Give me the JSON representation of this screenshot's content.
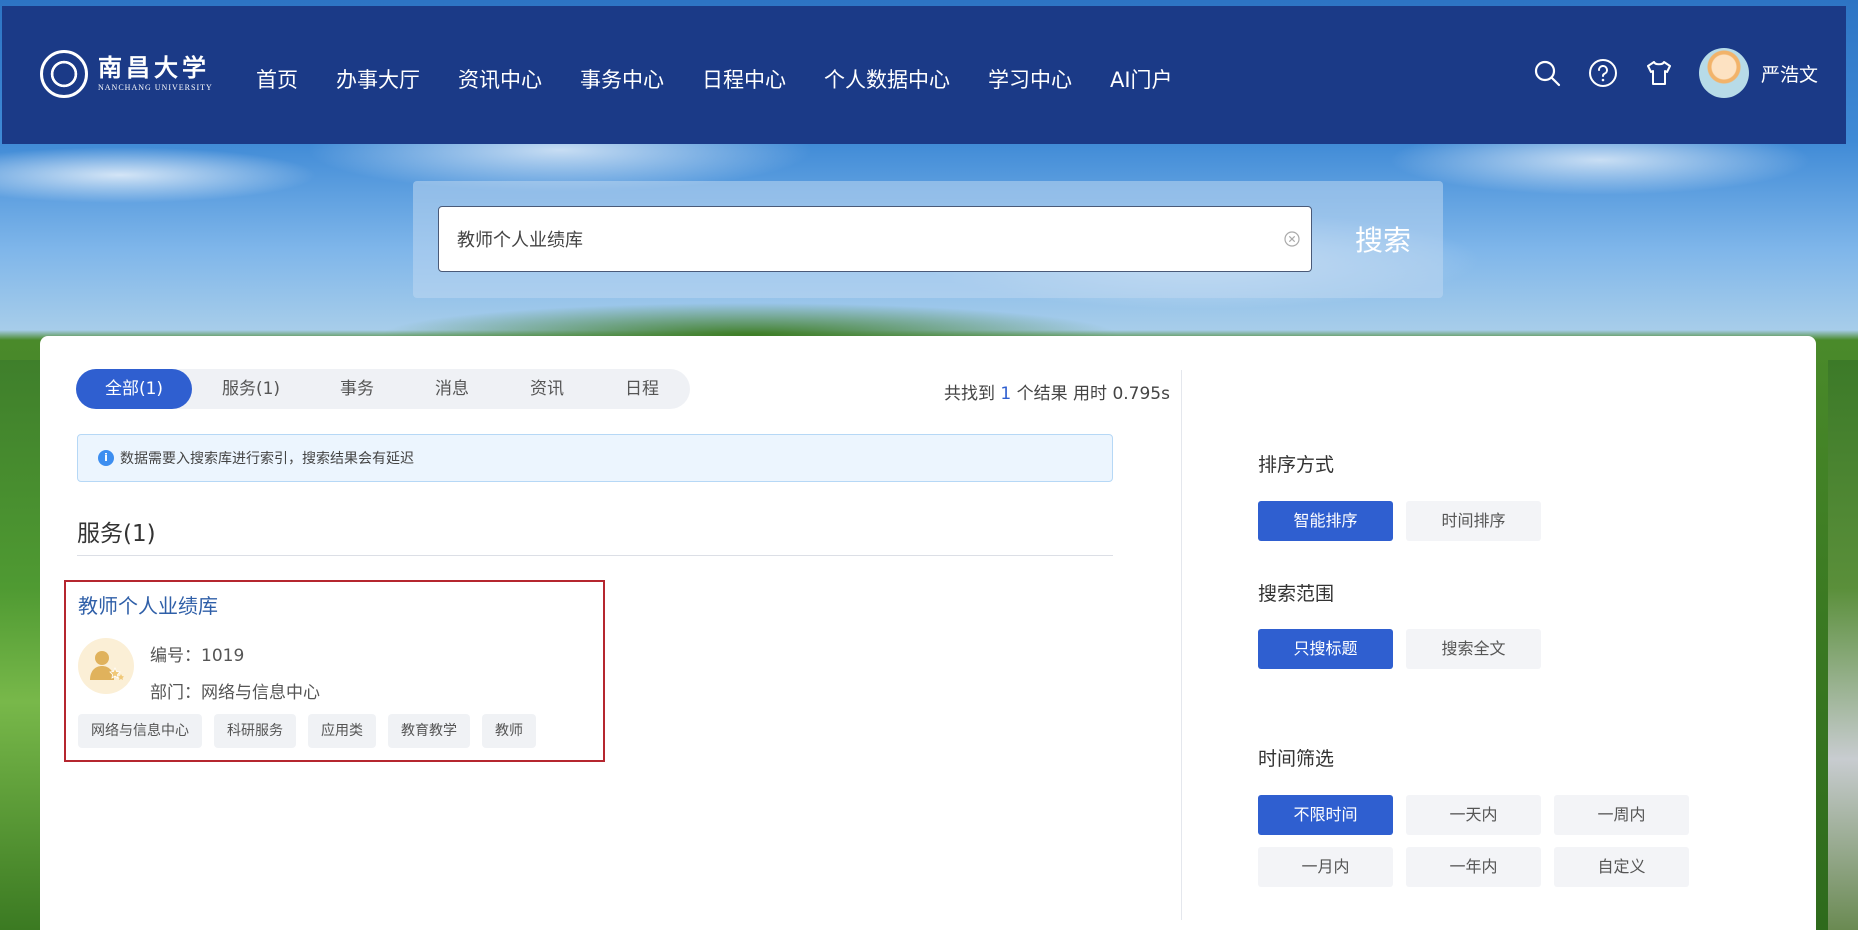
{
  "header": {
    "logo_cn": "南昌大学",
    "logo_en": "NANCHANG UNIVERSITY",
    "nav": [
      "首页",
      "办事大厅",
      "资讯中心",
      "事务中心",
      "日程中心",
      "个人数据中心",
      "学习中心",
      "AI门户"
    ],
    "icons": [
      "search-icon",
      "help-icon",
      "shirt-icon"
    ],
    "username": "严浩文"
  },
  "search": {
    "value": "教师个人业绩库",
    "button_label": "搜索"
  },
  "tabs": [
    {
      "label": "全部(1)",
      "active": true
    },
    {
      "label": "服务(1)",
      "active": false
    },
    {
      "label": "事务",
      "active": false
    },
    {
      "label": "消息",
      "active": false
    },
    {
      "label": "资讯",
      "active": false
    },
    {
      "label": "日程",
      "active": false
    }
  ],
  "result_info": {
    "prefix": "共找到",
    "count": "1",
    "middle": "个结果 用时",
    "time": "0.795s"
  },
  "notice": "数据需要入搜索库进行索引，搜索结果会有延迟",
  "section_title": "服务(1)",
  "result": {
    "title": "教师个人业绩库",
    "code_label": "编号：",
    "code": "1019",
    "dept_label": "部门：",
    "dept": "网络与信息中心",
    "tags": [
      "网络与信息中心",
      "科研服务",
      "应用类",
      "教育教学",
      "教师"
    ]
  },
  "sidebar": {
    "sort_label": "排序方式",
    "sort_options": [
      {
        "label": "智能排序",
        "active": true
      },
      {
        "label": "时间排序",
        "active": false
      }
    ],
    "scope_label": "搜索范围",
    "scope_options": [
      {
        "label": "只搜标题",
        "active": true
      },
      {
        "label": "搜索全文",
        "active": false
      }
    ],
    "time_label": "时间筛选",
    "time_options": [
      {
        "label": "不限时间",
        "active": true
      },
      {
        "label": "一天内",
        "active": false
      },
      {
        "label": "一周内",
        "active": false
      },
      {
        "label": "一月内",
        "active": false
      },
      {
        "label": "一年内",
        "active": false
      },
      {
        "label": "自定义",
        "active": false
      }
    ]
  },
  "colors": {
    "header_bg": "#1b3a87",
    "accent": "#2f5fd0",
    "highlight_border": "#b5262f"
  }
}
